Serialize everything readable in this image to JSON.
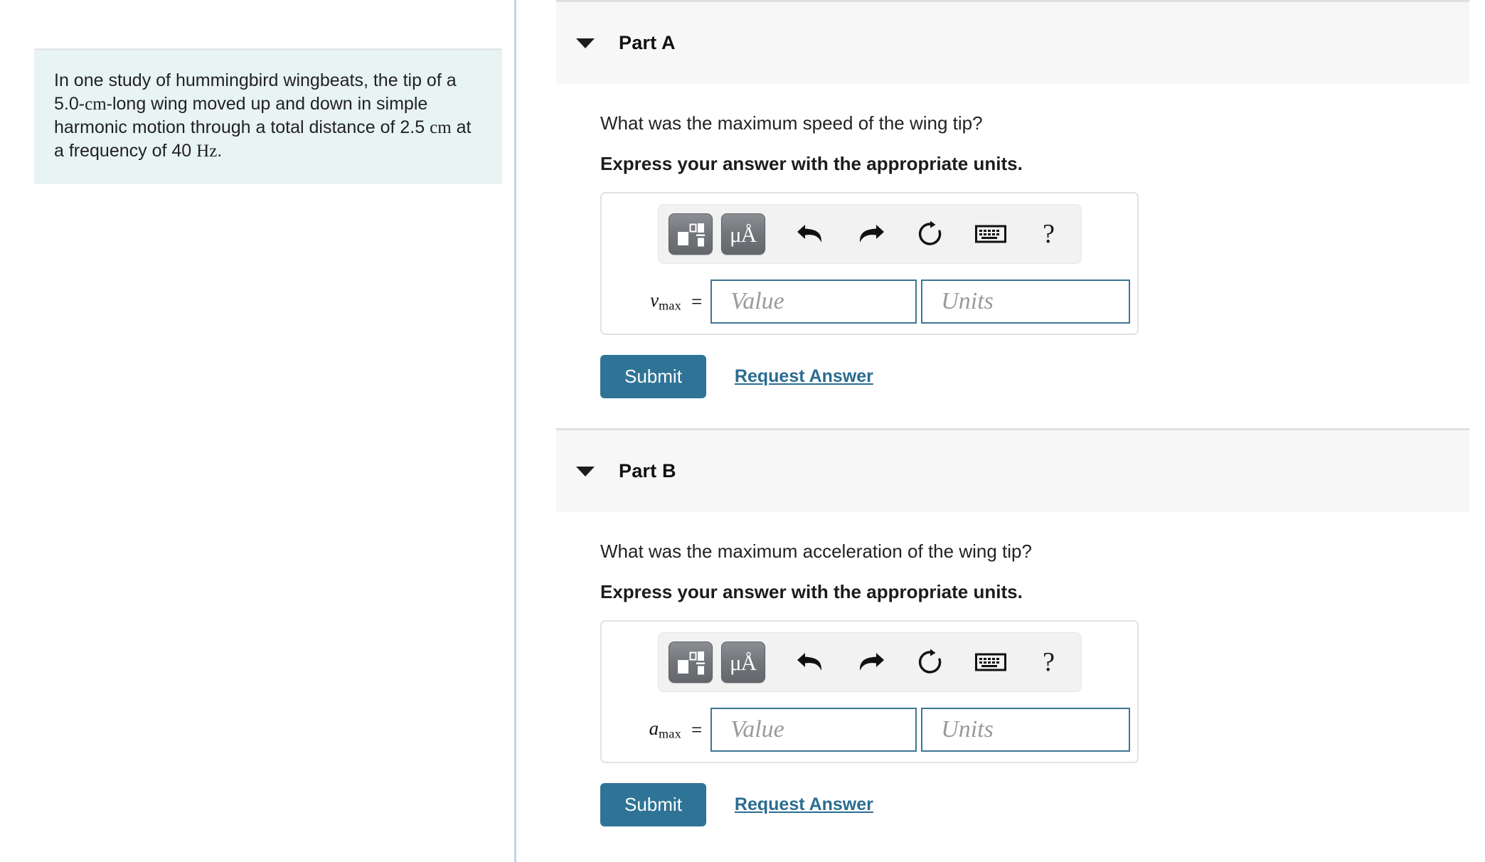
{
  "problem": {
    "text_before_unit1": "In one study of hummingbird wingbeats, the tip of a 5.0-",
    "unit1": "cm",
    "text_mid": "-long wing moved up and down in simple harmonic motion through a total distance of 2.5 ",
    "unit2": "cm",
    "text_mid2": " at a frequency of 40 ",
    "unit3": "Hz",
    "text_end": "."
  },
  "parts": [
    {
      "header": "Part A",
      "caret": "chevron-down-icon",
      "question": "What was the maximum speed of the wing tip?",
      "express": "Express your answer with the appropriate units.",
      "variable": "v",
      "subscript": "max",
      "equals": "=",
      "value_placeholder": "Value",
      "units_placeholder": "Units",
      "value": "",
      "units": "",
      "submit_label": "Submit",
      "request_label": "Request Answer"
    },
    {
      "header": "Part B",
      "caret": "chevron-down-icon",
      "question": "What was the maximum acceleration of the wing tip?",
      "express": "Express your answer with the appropriate units.",
      "variable": "a",
      "subscript": "max",
      "equals": "=",
      "value_placeholder": "Value",
      "units_placeholder": "Units",
      "value": "",
      "units": "",
      "submit_label": "Submit",
      "request_label": "Request Answer"
    }
  ],
  "toolbar": {
    "template_button": "math-template-icon",
    "units_button_label": "μÅ",
    "undo_button": "undo-arrow-icon",
    "redo_button": "redo-arrow-icon",
    "reset_button": "reset-circular-arrow-icon",
    "keyboard_button": "keyboard-icon",
    "help_button_label": "?"
  },
  "colors": {
    "accent": "#2f7496",
    "link": "#2b6d91",
    "input_border": "#3c7693",
    "problem_bg": "#e8f4f3",
    "header_bg": "#f7f7f7",
    "divider": "#c3d4de"
  }
}
